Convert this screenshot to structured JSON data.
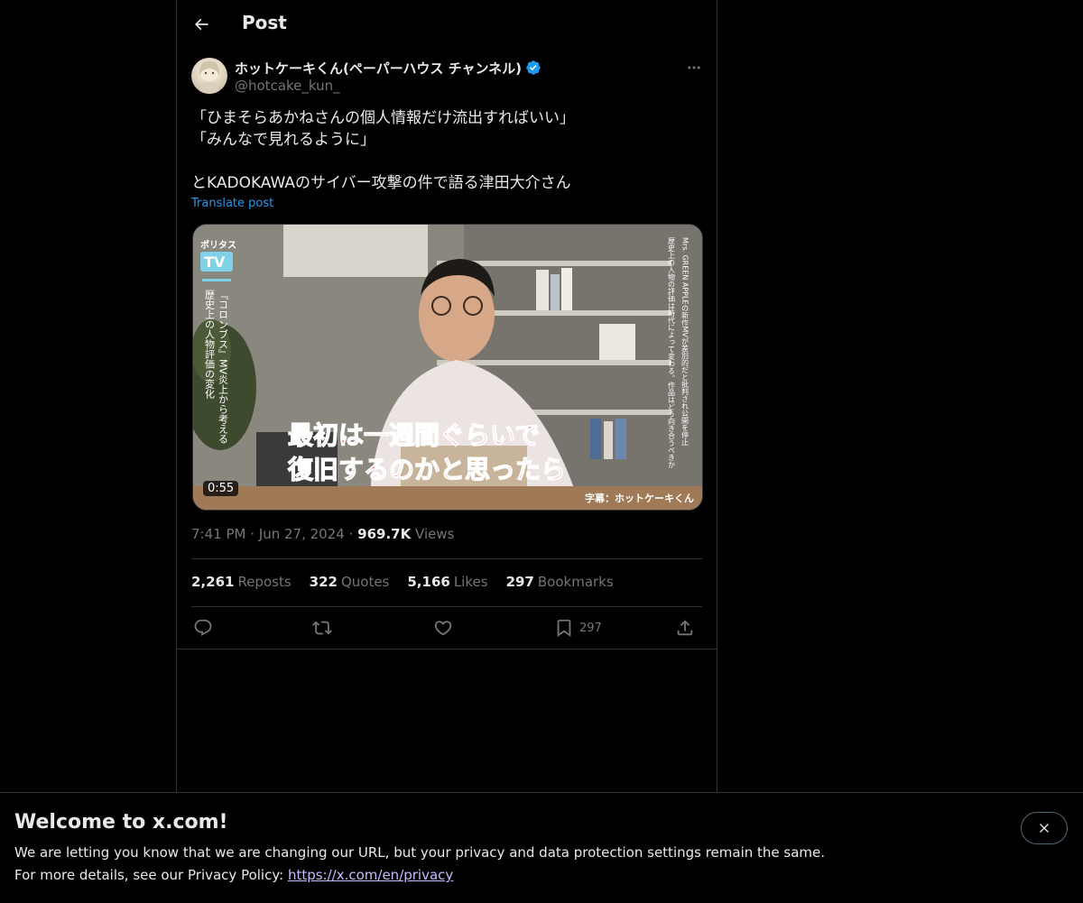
{
  "header": {
    "title": "Post",
    "back_icon": "arrow-left-icon"
  },
  "post": {
    "author": {
      "name": "ホットケーキくん(ペーパーハウス チャンネル)",
      "handle": "@hotcake_kun_",
      "verified": true
    },
    "text_lines": [
      "「ひまそらあかねさんの個人情報だけ流出すればいい」",
      "「みんなで見れるように」",
      "",
      "とKADOKAWAのサイバー攻撃の件で語る津田大介さん"
    ],
    "translate_label": "Translate post",
    "video": {
      "duration": "0:55",
      "logo_small": "ポリタス",
      "logo_tv": "TV",
      "left_caption_1": "『コロンブス』MV炎上から考える",
      "left_caption_2": "歴史上の人物評価の変化",
      "right_caption_1": "Mrs. GREEN APPLEの新作MVが差別的だと批判され公開を停止",
      "right_caption_2": "歴史上の人物の評価は時代によって変わる。作品はどう向き合うべきか",
      "subtitle_line_1": "最初は一週間ぐらいで",
      "subtitle_line_2": "復旧するのかと思ったら",
      "credit": "字幕：ホットケーキくん"
    },
    "time": "7:41 PM",
    "date": "Jun 27, 2024",
    "separator": "·",
    "views_count": "969.7K",
    "views_label": "Views"
  },
  "stats": {
    "reposts": {
      "count": "2,261",
      "label": "Reposts"
    },
    "quotes": {
      "count": "322",
      "label": "Quotes"
    },
    "likes": {
      "count": "5,166",
      "label": "Likes"
    },
    "bookmarks": {
      "count": "297",
      "label": "Bookmarks"
    }
  },
  "actions": {
    "reply_icon": "reply-icon",
    "repost_icon": "repost-icon",
    "like_icon": "heart-icon",
    "bookmark_icon": "bookmark-icon",
    "bookmark_count": "297",
    "share_icon": "share-icon"
  },
  "banner": {
    "title": "Welcome to x.com!",
    "line1": "We are letting you know that we are changing our URL, but your privacy and data protection settings remain the same.",
    "line2_prefix": "For more details, see our Privacy Policy: ",
    "link": "https://x.com/en/privacy",
    "close_icon": "close-icon"
  },
  "colors": {
    "background": "#000000",
    "text": "#e7e9ea",
    "muted": "#71767b",
    "accent": "#1d9bf0",
    "border": "#2f3336",
    "verified": "#1d9bf0",
    "link_visited": "#c5bcff"
  }
}
